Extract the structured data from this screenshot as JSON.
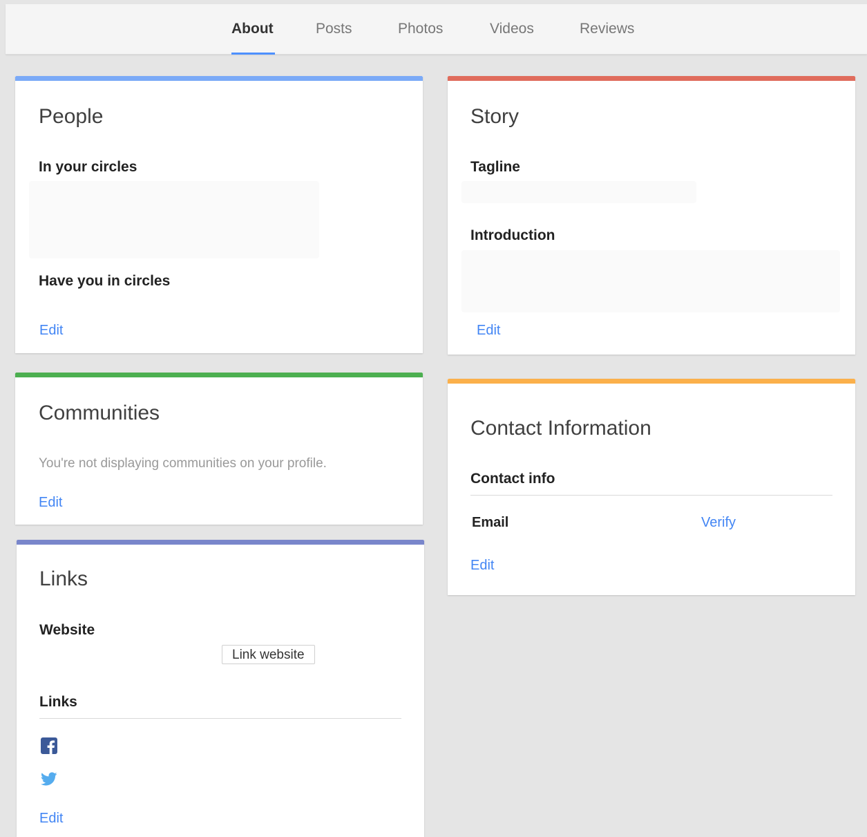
{
  "nav": {
    "tabs": [
      {
        "label": "About",
        "active": true
      },
      {
        "label": "Posts"
      },
      {
        "label": "Photos"
      },
      {
        "label": "Videos"
      },
      {
        "label": "Reviews"
      }
    ]
  },
  "colors": {
    "people": "#7baaf7",
    "story": "#e06c5c",
    "communities": "#4caf50",
    "contact": "#fbb04b",
    "links": "#7986cb",
    "link_text": "#4285f4"
  },
  "people": {
    "title": "People",
    "in_circles": "In your circles",
    "have_you": "Have you in circles",
    "edit": "Edit"
  },
  "story": {
    "title": "Story",
    "tagline": "Tagline",
    "introduction": "Introduction",
    "edit": "Edit"
  },
  "communities": {
    "title": "Communities",
    "message": "You're not displaying communities on your profile.",
    "edit": "Edit"
  },
  "contact": {
    "title": "Contact Information",
    "contact_info": "Contact info",
    "email_label": "Email",
    "verify": "Verify",
    "edit": "Edit"
  },
  "links": {
    "title": "Links",
    "website": "Website",
    "link_website": "Link website",
    "links_heading": "Links",
    "icons": [
      "facebook-icon",
      "twitter-icon"
    ],
    "edit": "Edit"
  }
}
